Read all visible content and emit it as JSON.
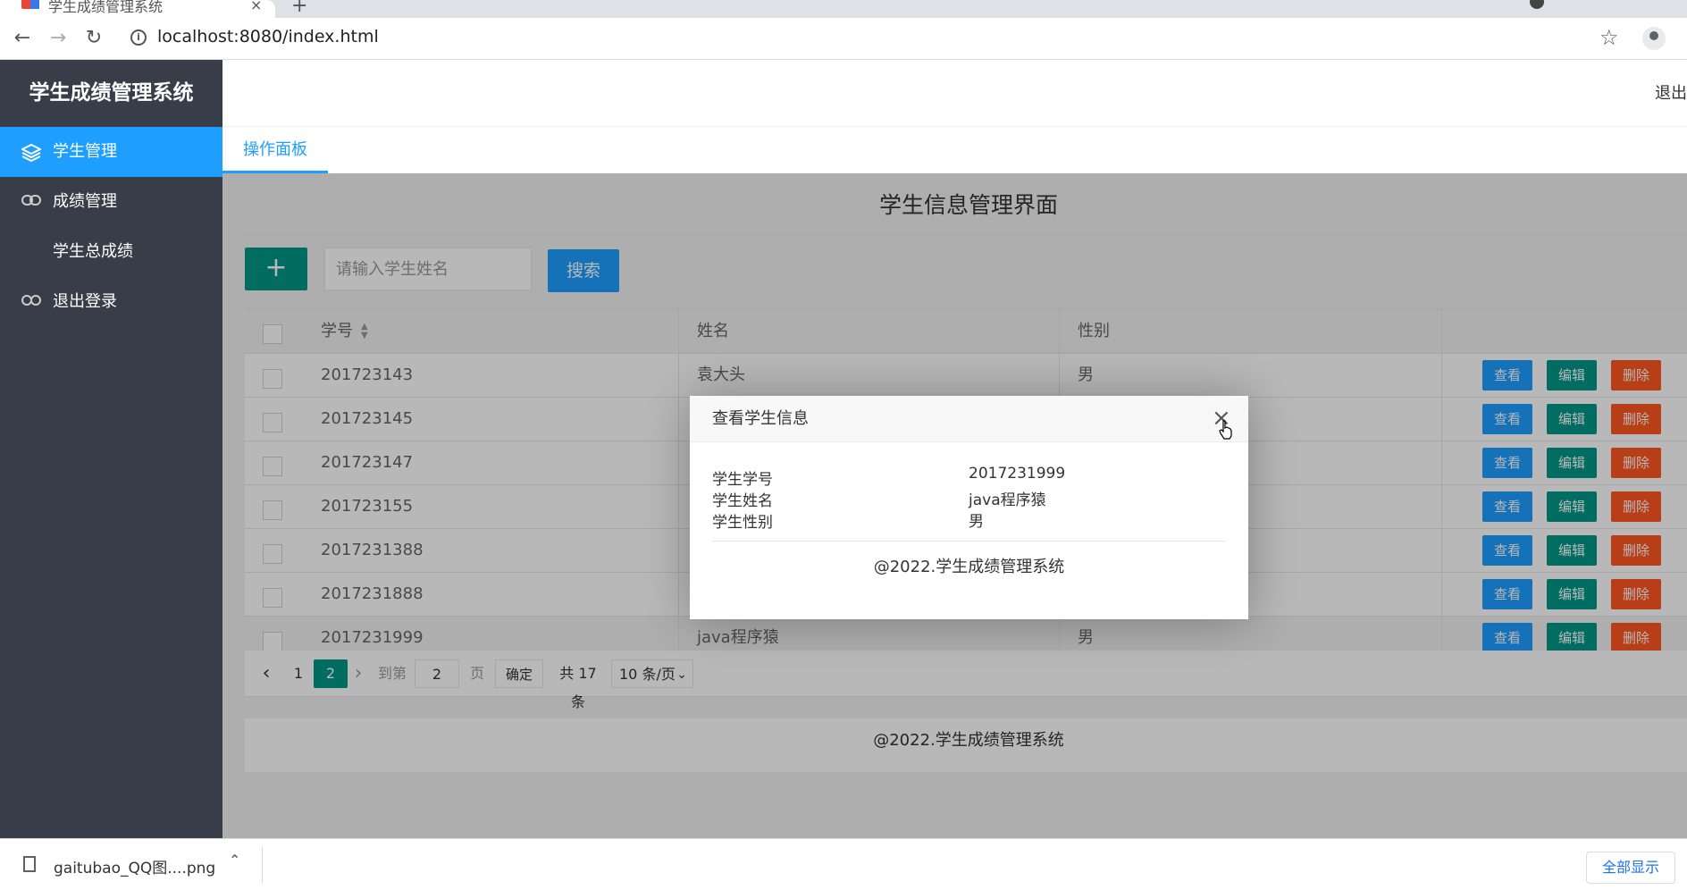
{
  "browser": {
    "tab_title": "学生成绩管理系统",
    "tab_close": "×",
    "new_tab": "+",
    "url": "localhost:8080/index.html"
  },
  "app": {
    "logo": "学生成绩管理系统",
    "logout_top": "退出",
    "nav": [
      {
        "label": "学生管理",
        "icon": "layers-icon",
        "active": true
      },
      {
        "label": "成绩管理",
        "icon": "link-icon",
        "active": false
      },
      {
        "label": "学生总成绩",
        "icon": "",
        "active": false
      },
      {
        "label": "退出登录",
        "icon": "logout-icon",
        "active": false
      }
    ],
    "tab": "操作面板"
  },
  "main": {
    "title": "学生信息管理界面",
    "add_label": "+",
    "search_placeholder": "请输入学生姓名",
    "search_label": "搜索",
    "columns": [
      "学号",
      "姓名",
      "性别"
    ],
    "rows": [
      {
        "id": "201723143",
        "name": "袁大头",
        "gender": "男"
      },
      {
        "id": "201723145",
        "name": "",
        "gender": ""
      },
      {
        "id": "201723147",
        "name": "",
        "gender": ""
      },
      {
        "id": "201723155",
        "name": "",
        "gender": ""
      },
      {
        "id": "2017231388",
        "name": "",
        "gender": ""
      },
      {
        "id": "2017231888",
        "name": "",
        "gender": ""
      },
      {
        "id": "2017231999",
        "name": "java程序猿",
        "gender": "男"
      }
    ],
    "actions": {
      "view": "查看",
      "edit": "编辑",
      "delete": "删除"
    },
    "pager": {
      "prev": "‹",
      "page1": "1",
      "current": "2",
      "next": "›",
      "goto_label": "到第",
      "goto_value": "2",
      "page_unit": "页",
      "confirm": "确定",
      "total": "共 17 条",
      "per_page": "10 条/页"
    },
    "footer": "@2022.学生成绩管理系统"
  },
  "modal": {
    "title": "查看学生信息",
    "close": "×",
    "fields": [
      {
        "label": "学生学号",
        "value": "2017231999"
      },
      {
        "label": "学生姓名",
        "value": "java程序猿"
      },
      {
        "label": "学生性别",
        "value": "男"
      }
    ],
    "footer": "@2022.学生成绩管理系统"
  },
  "download": {
    "filename": "gaitubao_QQ图....png",
    "show_all": "全部显示"
  },
  "colors": {
    "sidebar": "#393d49",
    "accent_blue": "#1e9fff",
    "accent_green": "#009688",
    "danger": "#ff5722"
  }
}
